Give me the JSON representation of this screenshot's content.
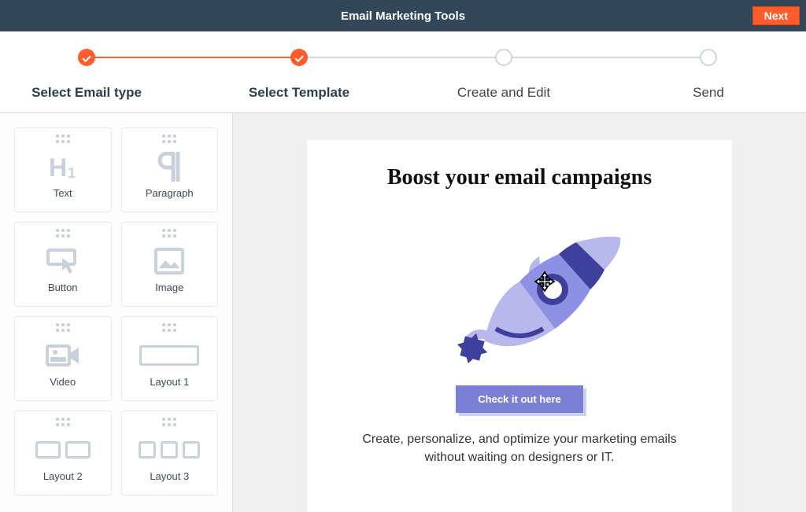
{
  "header": {
    "title": "Email Marketing Tools",
    "next_label": "Next"
  },
  "stepper": {
    "steps": [
      {
        "label": "Select Email type",
        "state": "done"
      },
      {
        "label": "Select Template",
        "state": "done"
      },
      {
        "label": "Create and Edit",
        "state": "pending"
      },
      {
        "label": "Send",
        "state": "pending"
      }
    ]
  },
  "tools": [
    {
      "label": "Text",
      "icon": "heading"
    },
    {
      "label": "Paragraph",
      "icon": "pilcrow"
    },
    {
      "label": "Button",
      "icon": "button"
    },
    {
      "label": "Image",
      "icon": "image"
    },
    {
      "label": "Video",
      "icon": "video"
    },
    {
      "label": "Layout 1",
      "icon": "layout1"
    },
    {
      "label": "Layout 2",
      "icon": "layout2"
    },
    {
      "label": "Layout 3",
      "icon": "layout3"
    }
  ],
  "preview": {
    "headline": "Boost your email campaigns",
    "cta_label": "Check it out here",
    "body": "Create, personalize, and optimize your marketing emails without waiting on designers or IT."
  },
  "colors": {
    "accent_orange": "#ff5c2e",
    "header_navy": "#33475b",
    "rocket_purple": "#7b7fd6",
    "rocket_dark": "#3f3f9e",
    "icon_gray": "#c9d1dc"
  }
}
